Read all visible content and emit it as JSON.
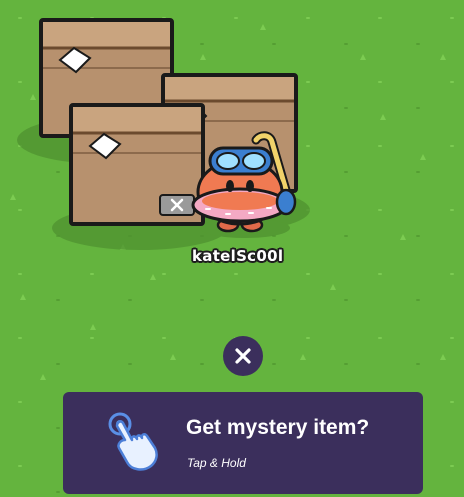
{
  "colors": {
    "grass": "#64b43e",
    "panel": "#3b2f5c",
    "text": "#ffffff"
  },
  "scene": {
    "objects": [
      "cardboard-box",
      "cardboard-box",
      "cardboard-box",
      "player-character"
    ]
  },
  "player": {
    "name": "katelSc00l"
  },
  "close_button": {
    "icon": "close-icon"
  },
  "prompt": {
    "icon": "tap-hand-icon",
    "title": "Get mystery item?",
    "subtitle": "Tap & Hold"
  }
}
